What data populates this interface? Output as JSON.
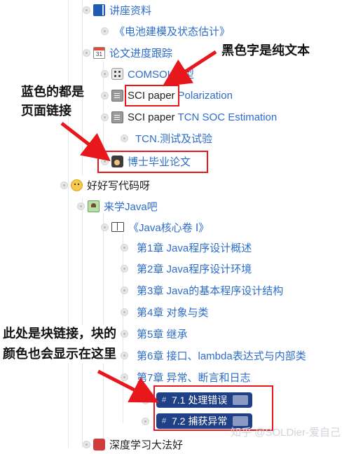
{
  "outline": {
    "item1": {
      "icon": "blue-book-icon",
      "label": "讲座资料"
    },
    "item2": {
      "label": "《电池建模及状态估计》"
    },
    "item3": {
      "icon": "calendar-icon",
      "label": "论文进度跟踪"
    },
    "item4": {
      "icon": "dice-icon",
      "label": "COMSOL模型"
    },
    "item5": {
      "icon": "notebook-icon",
      "black_text": "SCI paper",
      "link_text": "Polarization"
    },
    "item6": {
      "icon": "notebook-icon",
      "black_text": "SCI paper",
      "link_text": "TCN SOC Estimation"
    },
    "item7": {
      "label": "TCN.测试及试验"
    },
    "item8": {
      "icon": "graduate-icon",
      "label": "博士毕业论文"
    },
    "item9": {
      "icon": "smile-icon",
      "label": "好好写代码呀"
    },
    "item10": {
      "icon": "java-icon",
      "label": "来学Java吧"
    },
    "item11": {
      "icon": "open-book-icon",
      "label": "《Java核心卷 Ⅰ》"
    },
    "chapters": [
      "第1章 Java程序设计概述",
      "第2章 Java程序设计环境",
      "第3章 Java的基本程序设计结构",
      "第4章 对象与类",
      "第5章 继承",
      "第6章 接口、lambda表达式与内部类",
      "第7章 异常、断言和日志"
    ],
    "block_links": [
      {
        "hash": "#",
        "label": "7.1 处理错误"
      },
      {
        "hash": "#",
        "label": "7.2 捕获异常"
      }
    ],
    "item_last": {
      "icon": "red-bag-icon",
      "label": "深度学习大法好"
    }
  },
  "annotations": {
    "black_text": "黑色字是纯文本",
    "blue_links": "蓝色的都是\n页面链接",
    "block_links_line1": "此处是块链接，块的",
    "block_links_line2": "颜色也会显示在这里"
  },
  "watermark": "知乎 @SOLDier-爱自己",
  "colors": {
    "link": "#2d6cc9",
    "callout": "#e8171c",
    "block_chip": "#1f3f86"
  }
}
